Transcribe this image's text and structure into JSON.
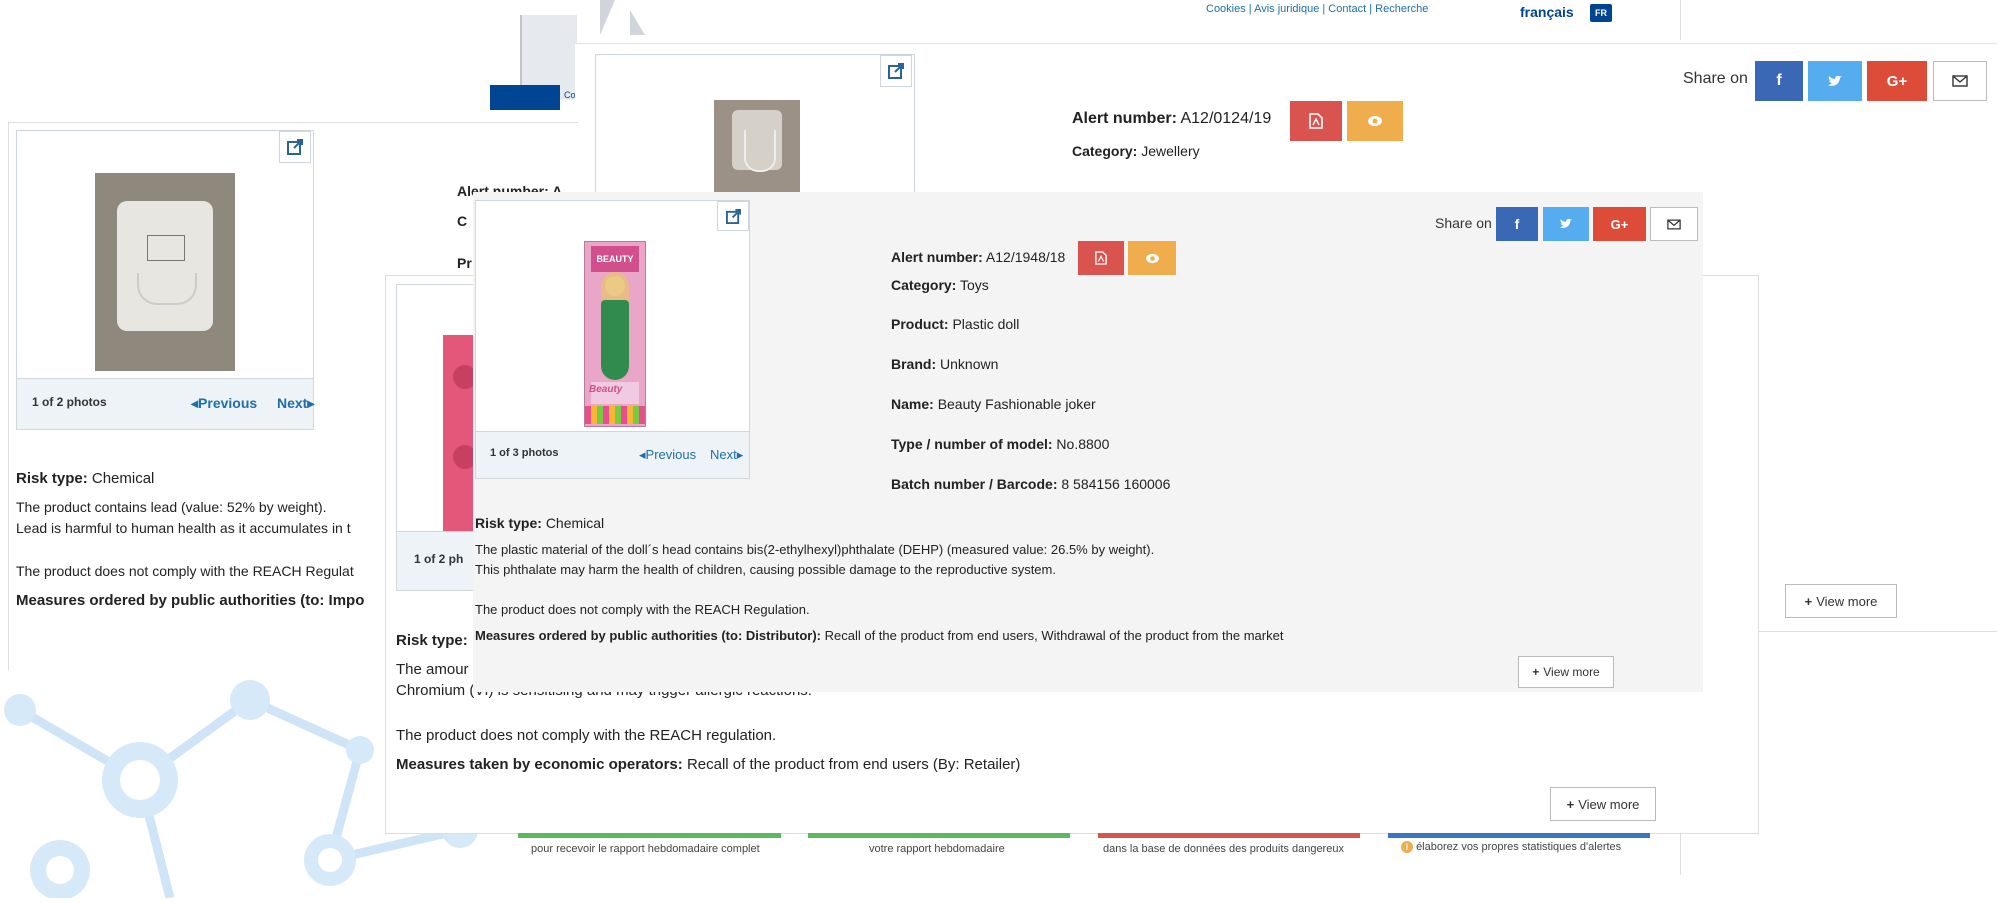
{
  "header": {
    "links": "Cookies | Avis juridique | Contact | Recherche",
    "language": "français",
    "language_code": "FR"
  },
  "share": {
    "label": "Share on"
  },
  "card_jewellery": {
    "alert_label": "Alert number:",
    "alert_value": "A12/0124/19",
    "category_label": "Category:",
    "category_value": "Jewellery"
  },
  "card_left": {
    "photos": "1 of 2 photos",
    "prev": "Previous",
    "next": "Next",
    "alert_label": "Alert number: A",
    "category_label": "C",
    "product_label": "Pr",
    "risk_label": "Risk type:",
    "risk_value": "Chemical",
    "desc1": "The product contains lead (value: 52% by weight).",
    "desc2": "Lead is harmful to human health as it accumulates in t",
    "compliance": "The product does not comply with the REACH Regulat",
    "measures": "Measures ordered by public authorities (to: Impo"
  },
  "card_middle": {
    "photos": "1 of 2 ph",
    "risk_label": "Risk type:",
    "desc1": "The amour",
    "desc2": "Chromium (VI) is sensitising and may trigger allergic reactions.",
    "compliance": "The product does not comply with the REACH regulation.",
    "measures_label": "Measures taken by economic operators:",
    "measures_value": "Recall of the product from end users (By: Retailer)",
    "view_more": "View more"
  },
  "card_right": {
    "view_more": "View more"
  },
  "card_doll": {
    "photos": "1 of 3 photos",
    "prev": "Previous",
    "next": "Next",
    "alert_label": "Alert number:",
    "alert_value": "A12/1948/18",
    "category_label": "Category:",
    "category_value": "Toys",
    "product_label": "Product:",
    "product_value": "Plastic doll",
    "brand_label": "Brand:",
    "brand_value": "Unknown",
    "name_label": "Name:",
    "name_value": "Beauty Fashionable joker",
    "model_label": "Type / number of model:",
    "model_value": "No.8800",
    "batch_label": "Batch number / Barcode:",
    "batch_value": "8 584156 160006",
    "risk_label": "Risk type:",
    "risk_value": "Chemical",
    "desc1": "The plastic material of the doll´s head contains bis(2-ethylhexyl)phthalate (DEHP) (measured value: 26.5% by weight).",
    "desc2": "This phthalate may harm the health of children, causing possible damage to the reproductive system.",
    "compliance": "The product does not comply with the REACH Regulation.",
    "measures_label": "Measures ordered by public authorities (to: Distributor):",
    "measures_value": "Recall of the product from end users, Withdrawal of the product from the market",
    "view_more": "View more",
    "box_text": "Beauty"
  },
  "footer": {
    "item1": "pour recevoir le rapport hebdomadaire complet",
    "item2": "votre rapport hebdomadaire",
    "item3": "dans la base de données des produits dangereux",
    "item4": "élaborez vos propres statistiques d'alertes"
  },
  "colors": {
    "facebook": "#3b68b4",
    "twitter": "#55acee",
    "google": "#dd4b39",
    "pdf": "#d9534f",
    "eye": "#f0ad4e",
    "link": "#1f6fa8",
    "footer_green": "#5cb85c",
    "footer_red": "#d9534f",
    "footer_blue": "#3a75c4"
  }
}
